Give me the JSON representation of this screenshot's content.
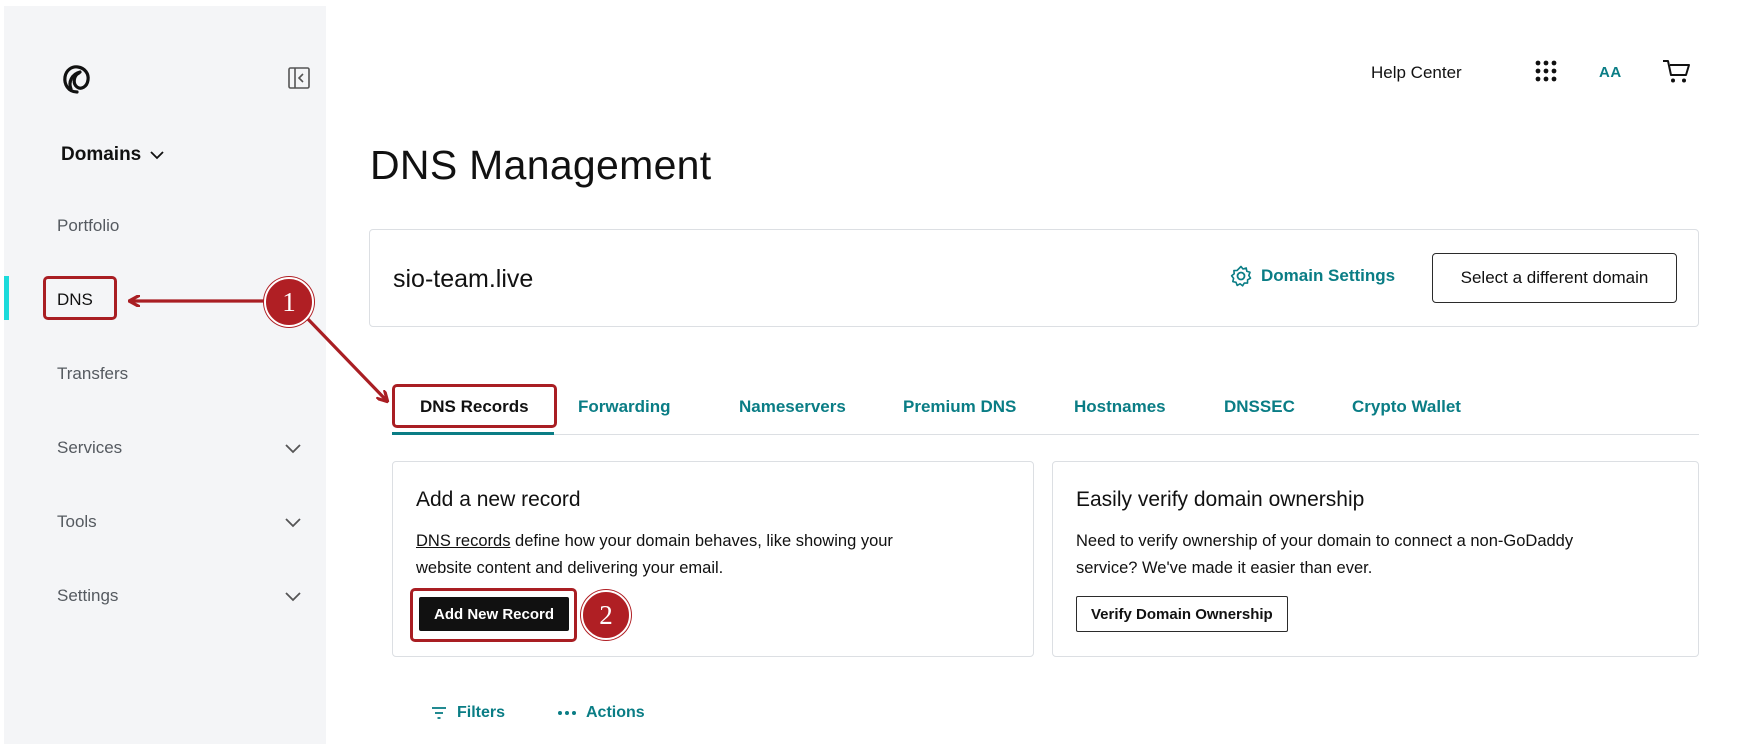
{
  "sidebar": {
    "heading": "Domains",
    "items": [
      {
        "label": "Portfolio"
      },
      {
        "label": "DNS"
      },
      {
        "label": "Transfers"
      },
      {
        "label": "Services"
      },
      {
        "label": "Tools"
      },
      {
        "label": "Settings"
      }
    ]
  },
  "topbar": {
    "help": "Help Center",
    "avatar": "AA"
  },
  "page": {
    "title": "DNS Management"
  },
  "domain_card": {
    "domain": "sio-team.live",
    "settings_label": "Domain Settings",
    "select_label": "Select a different domain"
  },
  "tabs": [
    {
      "label": "DNS Records"
    },
    {
      "label": "Forwarding"
    },
    {
      "label": "Nameservers"
    },
    {
      "label": "Premium DNS"
    },
    {
      "label": "Hostnames"
    },
    {
      "label": "DNSSEC"
    },
    {
      "label": "Crypto Wallet"
    }
  ],
  "add_record_card": {
    "title": "Add a new record",
    "link_text": "DNS records",
    "text_line1_rest": " define how your domain behaves, like showing your",
    "text_line2": "website content and delivering your email.",
    "button": "Add New Record"
  },
  "verify_card": {
    "title": "Easily verify domain ownership",
    "text_line1": "Need to verify ownership of your domain to connect a non-GoDaddy",
    "text_line2": "service? We've made it easier than ever.",
    "button": "Verify Domain Ownership"
  },
  "toolbar": {
    "filters": "Filters",
    "actions": "Actions"
  },
  "annotations": {
    "step1": "1",
    "step2": "2",
    "color": "#a91e23"
  },
  "colors": {
    "accent_teal": "#0a7d85",
    "active_bar": "#1bdbdb",
    "sidebar_bg": "#f4f5f7"
  }
}
